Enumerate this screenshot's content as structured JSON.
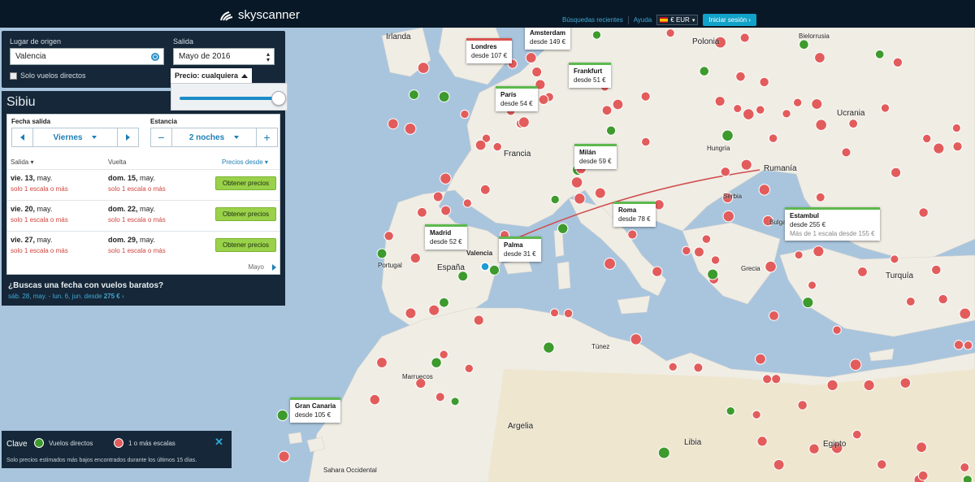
{
  "topbar": {
    "logo": "skyscanner",
    "recent": "Búsquedas recientes",
    "help": "Ayuda",
    "currency": "€ EUR",
    "login": "Iniciar sesión"
  },
  "search": {
    "origin_label": "Lugar de origen",
    "origin_value": "Valencia",
    "depart_label": "Salida",
    "depart_value": "Mayo de 2016",
    "direct_only": "Solo vuelos directos",
    "price_label": "Precio: cualquiera",
    "price_slider_level": 1.0
  },
  "destination": {
    "name": "Sibiu",
    "date_label": "Fecha salida",
    "date_value": "Viernes",
    "stay_label": "Estancia",
    "stay_value": "2 noches",
    "col_out": "Salida",
    "col_back": "Vuelta",
    "col_prices": "Precios desde",
    "rows": [
      {
        "out_day": "vie. 13,",
        "out_month": "may.",
        "out_note": "solo 1 escala o más",
        "back_day": "dom. 15,",
        "back_month": "may.",
        "back_note": "solo 1 escala o más",
        "button": "Obtener precios"
      },
      {
        "out_day": "vie. 20,",
        "out_month": "may.",
        "out_note": "solo 1 escala o más",
        "back_day": "dom. 22,",
        "back_month": "may.",
        "back_note": "solo 1 escala o más",
        "button": "Obtener precios"
      },
      {
        "out_day": "vie. 27,",
        "out_month": "may.",
        "out_note": "solo 1 escala o más",
        "back_day": "dom. 29,",
        "back_month": "may.",
        "back_note": "solo 1 escala o más",
        "button": "Obtener precios"
      }
    ],
    "month_nav": "Mayo",
    "cheap_question": "¿Buscas una fecha con vuelos baratos?",
    "cheap_dates": "sáb. 28, may. - lun. 6, jun. desde",
    "cheap_price": "275 €"
  },
  "legend": {
    "title": "Clave",
    "direct": "Vuelos directos",
    "stops": "1 o más escalas",
    "note": "Solo precios estimados más bajos encontrados durante los últimos 15 días."
  },
  "map": {
    "price_labels": [
      {
        "city": "Londres",
        "price": "desde 107 €",
        "color": "red"
      },
      {
        "city": "Amsterdam",
        "price": "desde 149 €",
        "color": "red"
      },
      {
        "city": "Frankfurt",
        "price": "desde 51 €",
        "color": "green"
      },
      {
        "city": "París",
        "price": "desde 54 €",
        "color": "green"
      },
      {
        "city": "Milán",
        "price": "desde 59 €",
        "color": "green"
      },
      {
        "city": "Roma",
        "price": "desde 78 €",
        "color": "green"
      },
      {
        "city": "Madrid",
        "price": "desde 52 €",
        "color": "green"
      },
      {
        "city": "Palma",
        "price": "desde 31 €",
        "color": "green"
      },
      {
        "city": "Estambul",
        "price": "desde 255 €",
        "extra": "Más de 1 escala desde 155 €",
        "color": "green"
      },
      {
        "city": "Gran Canaria",
        "price": "desde 105 €",
        "color": "green"
      }
    ],
    "origin_label": "Valencia",
    "countries": [
      "Irlanda",
      "Polonia",
      "Bielorrusia",
      "Ucrania",
      "Francia",
      "Rumanía",
      "España",
      "Portugal",
      "Turquía",
      "Marruecos",
      "Argelia",
      "Libia",
      "Egipto",
      "Túnez",
      "Grecia",
      "Bulgaria",
      "Serbia",
      "Hungría",
      "Sahara Occidental"
    ],
    "colors": {
      "direct": "#3d9a2d",
      "stops": "#e35c5c",
      "route": "#d04d4d"
    }
  }
}
